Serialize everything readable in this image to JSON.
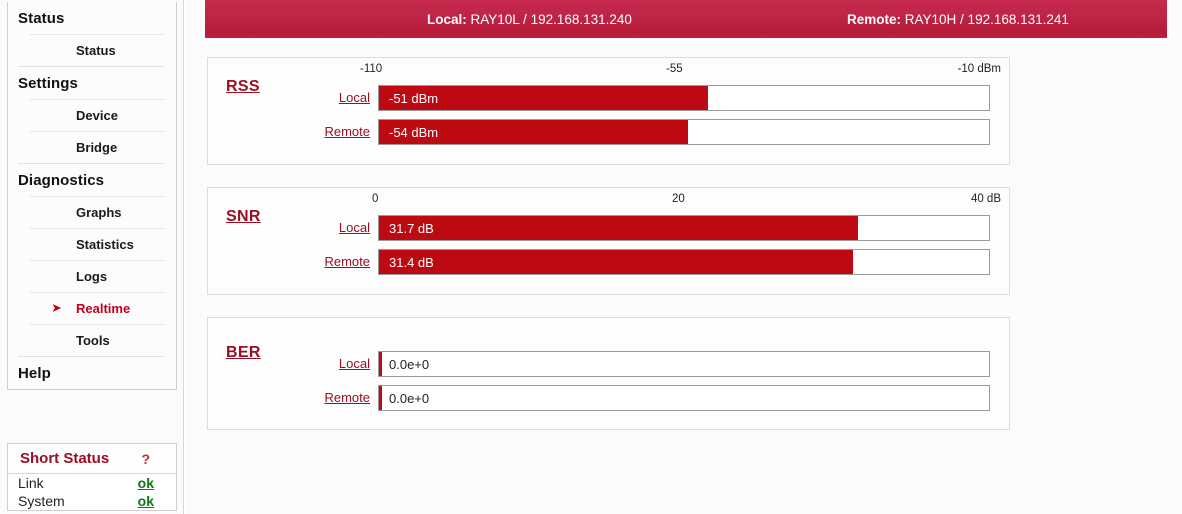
{
  "sidebar": {
    "nav": [
      {
        "label": "Status",
        "type": "group"
      },
      {
        "label": "Status",
        "type": "item"
      },
      {
        "label": "Settings",
        "type": "group"
      },
      {
        "label": "Device",
        "type": "item"
      },
      {
        "label": "Bridge",
        "type": "item"
      },
      {
        "label": "Diagnostics",
        "type": "group"
      },
      {
        "label": "Graphs",
        "type": "item"
      },
      {
        "label": "Statistics",
        "type": "item"
      },
      {
        "label": "Logs",
        "type": "item"
      },
      {
        "label": "Realtime",
        "type": "item",
        "active": true,
        "marker": "➤"
      },
      {
        "label": "Tools",
        "type": "item"
      },
      {
        "label": "Help",
        "type": "group"
      }
    ],
    "short_status": {
      "title": "Short Status",
      "help_glyph": "?",
      "rows": [
        {
          "label": "Link",
          "value": "ok"
        },
        {
          "label": "System",
          "value": "ok"
        }
      ]
    }
  },
  "header": {
    "local_label": "Local:",
    "local_value": "RAY10L / 192.168.131.240",
    "remote_label": "Remote:",
    "remote_value": "RAY10H / 192.168.131.241"
  },
  "panels": [
    {
      "title": "RSS",
      "scale": {
        "min": "-110",
        "mid": "-55",
        "max": "-10 dBm"
      },
      "rows": [
        {
          "label": "Local",
          "value": "-51 dBm",
          "fill_pct": 54.0,
          "text_inside": true
        },
        {
          "label": "Remote",
          "value": "-54 dBm",
          "fill_pct": 50.7,
          "text_inside": true
        }
      ]
    },
    {
      "title": "SNR",
      "scale": {
        "min": "0",
        "mid": "20",
        "max": "40 dB"
      },
      "rows": [
        {
          "label": "Local",
          "value": "31.7 dB",
          "fill_pct": 78.5,
          "text_inside": true
        },
        {
          "label": "Remote",
          "value": "31.4 dB",
          "fill_pct": 77.7,
          "text_inside": true
        }
      ]
    },
    {
      "title": "BER",
      "scale": {
        "min": "",
        "mid": "",
        "max": ""
      },
      "rows": [
        {
          "label": "Local",
          "value": "0.0e+0",
          "fill_pct": 0.5,
          "text_inside": false
        },
        {
          "label": "Remote",
          "value": "0.0e+0",
          "fill_pct": 0.5,
          "text_inside": false
        }
      ]
    }
  ],
  "chart_data": {
    "type": "bar",
    "title": "Realtime link metrics",
    "panels": [
      {
        "name": "RSS",
        "unit": "dBm",
        "xlim": [
          -110,
          -10
        ],
        "ticks": [
          -110,
          -55,
          -10
        ],
        "categories": [
          "Local",
          "Remote"
        ],
        "values": [
          -51,
          -54
        ]
      },
      {
        "name": "SNR",
        "unit": "dB",
        "xlim": [
          0,
          40
        ],
        "ticks": [
          0,
          20,
          40
        ],
        "categories": [
          "Local",
          "Remote"
        ],
        "values": [
          31.7,
          31.4
        ]
      },
      {
        "name": "BER",
        "unit": "",
        "xlim": [
          0,
          1
        ],
        "ticks": [],
        "categories": [
          "Local",
          "Remote"
        ],
        "values": [
          0.0,
          0.0
        ]
      }
    ],
    "colors": {
      "bar": "#bd0a12",
      "accent": "#9a0f22",
      "header": "#be2547",
      "ok": "#0c7a0c"
    }
  }
}
